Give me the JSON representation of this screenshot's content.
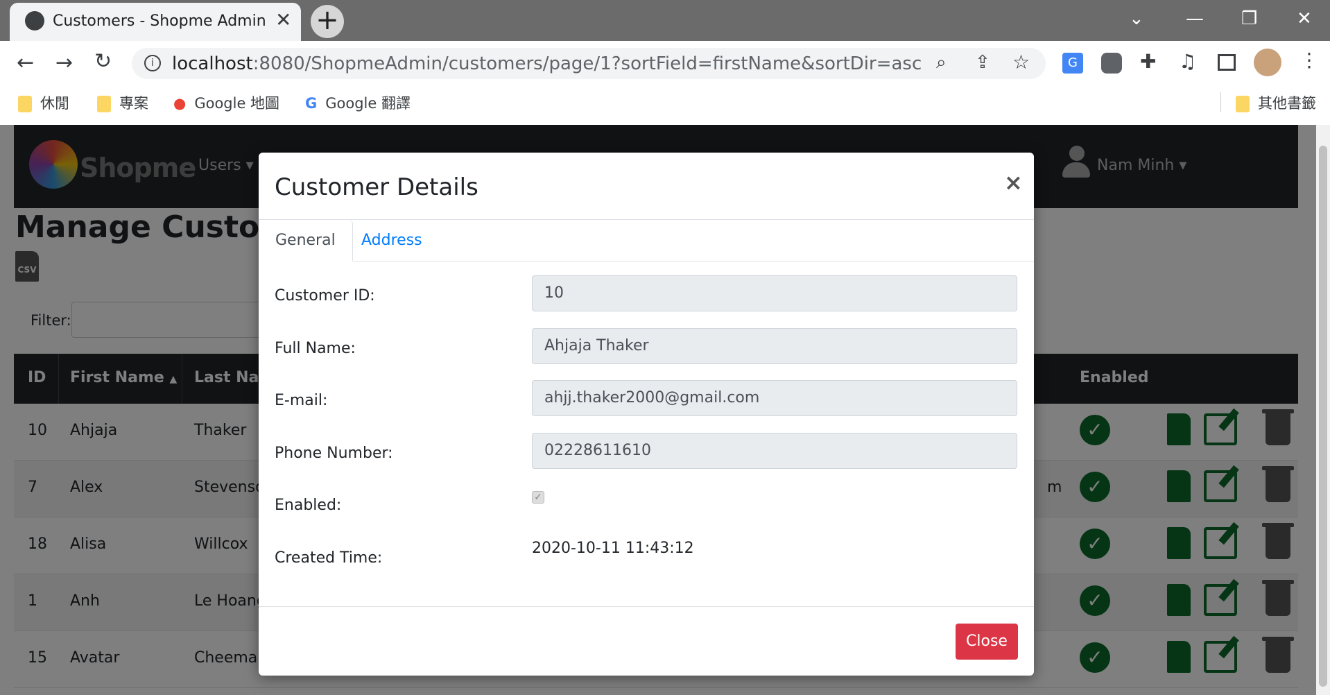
{
  "browser": {
    "tab_title": "Customers - Shopme Admin",
    "url_host": "localhost",
    "url_rest": ":8080/ShopmeAdmin/customers/page/1?sortField=firstName&sortDir=asc",
    "bookmarks": [
      "休閒",
      "專案",
      "Google 地圖",
      "Google 翻譯"
    ],
    "other_bookmarks": "其他書籤"
  },
  "page": {
    "brand": "Shopme",
    "nav_users": "Users",
    "nav_user_name": "Nam Minh",
    "heading": "Manage Custome",
    "csv_label": "CSV",
    "filter_label": "Filter:",
    "table_headers": [
      "ID",
      "First Name",
      "Last Nam",
      "Enabled"
    ],
    "rows": [
      {
        "id": "10",
        "first": "Ahjaja",
        "last": "Thaker"
      },
      {
        "id": "7",
        "first": "Alex",
        "last": "Stevenso",
        "extra": "m"
      },
      {
        "id": "18",
        "first": "Alisa",
        "last": "Willcox"
      },
      {
        "id": "1",
        "first": "Anh",
        "last": "Le Hoang"
      },
      {
        "id": "15",
        "first": "Avatar",
        "last": "Cheema"
      }
    ]
  },
  "modal": {
    "title": "Customer Details",
    "close_x": "×",
    "tabs": [
      "General",
      "Address"
    ],
    "fields": [
      {
        "label": "Customer ID:",
        "value": "10"
      },
      {
        "label": "Full Name:",
        "value": "Ahjaja Thaker"
      },
      {
        "label": "E-mail:",
        "value": "ahjj.thaker2000@gmail.com"
      },
      {
        "label": "Phone Number:",
        "value": "02228611610"
      }
    ],
    "enabled_label": "Enabled:",
    "enabled_checked": true,
    "created_label": "Created Time:",
    "created_value": "2020-10-11 11:43:12",
    "close_button": "Close"
  },
  "colors": {
    "accent": "#007bff",
    "danger": "#dc3545",
    "success": "#0b6b2a",
    "navbar": "#212529"
  }
}
